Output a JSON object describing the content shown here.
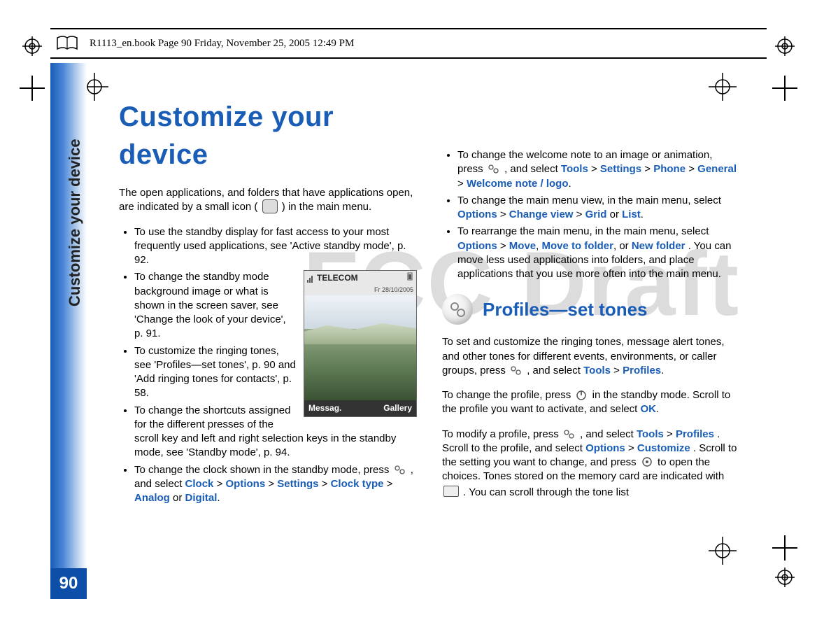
{
  "meta": {
    "book_header": "R1113_en.book  Page 90  Friday, November 25, 2005  12:49 PM",
    "page_number": "90",
    "side_label": "Customize your device",
    "watermark": "FCC Draft"
  },
  "col1": {
    "heading": "Customize your device",
    "intro_a": "The open applications, and folders that have applications open, are indicated by a small icon (",
    "intro_b": ") in the main menu.",
    "phone": {
      "carrier": "TELECOM",
      "date": "Fr 28/10/2005",
      "softkey_left": "Messag.",
      "softkey_right": "Gallery"
    },
    "b1": "To use the standby display for fast access to your most frequently used applications, see 'Active standby mode', p. 92.",
    "b2": "To change the standby mode background image or what is shown in the screen saver, see 'Change the look of your device', p. 91.",
    "b3": "To customize the ringing tones, see 'Profiles—set tones', p. 90 and 'Add ringing tones for contacts', p. 58.",
    "b4": "To change the shortcuts assigned for the different presses of the scroll key and left and right selection keys in the standby mode, see 'Standby mode', p. 94.",
    "b5a": "To change the clock shown in the standby mode, press ",
    "b5b": ", and select ",
    "links": {
      "clock": "Clock",
      "options": "Options",
      "settings": "Settings",
      "clock_type": "Clock type",
      "analog": "Analog",
      "digital": "Digital"
    },
    "gt": " > ",
    "or": " or ",
    "period": "."
  },
  "col2": {
    "b1a": "To change the welcome note to an image or animation, press ",
    "b1b": ", and select ",
    "b2a": "To change the main menu view, in the main menu, select ",
    "b3a": "To rearrange the main menu, in the main menu, select ",
    "b3b": ". You can move less used applications into folders, and place applications that you use more often into the main menu.",
    "links": {
      "tools": "Tools",
      "settings": "Settings",
      "phone": "Phone",
      "general": "General",
      "welcome": "Welcome note / logo",
      "options": "Options",
      "change_view": "Change view",
      "grid": "Grid",
      "list": "List",
      "move": "Move",
      "move_to_folder": "Move to folder",
      "new_folder": "New folder",
      "profiles": "Profiles",
      "customize": "Customize",
      "ok": "OK"
    },
    "section_title": "Profiles—set tones",
    "p1a": "To set and customize the ringing tones, message alert tones, and other tones for different events, environments, or caller groups, press ",
    "p1b": ", and select ",
    "p2a": "To change the profile, press ",
    "p2b": " in the standby mode. Scroll to the profile you want to activate, and select ",
    "p3a": "To modify a profile, press ",
    "p3b": ", and select ",
    "p3c": ". Scroll to the profile, and select ",
    "p3d": ". Scroll to the setting you want to change, and press ",
    "p3e": " to open the choices. Tones stored on the memory card are indicated with ",
    "p3f": ". You can scroll through the tone list",
    "gt": " > ",
    "or": " or ",
    "comma_or": ", or ",
    "comma": ", ",
    "period": "."
  }
}
